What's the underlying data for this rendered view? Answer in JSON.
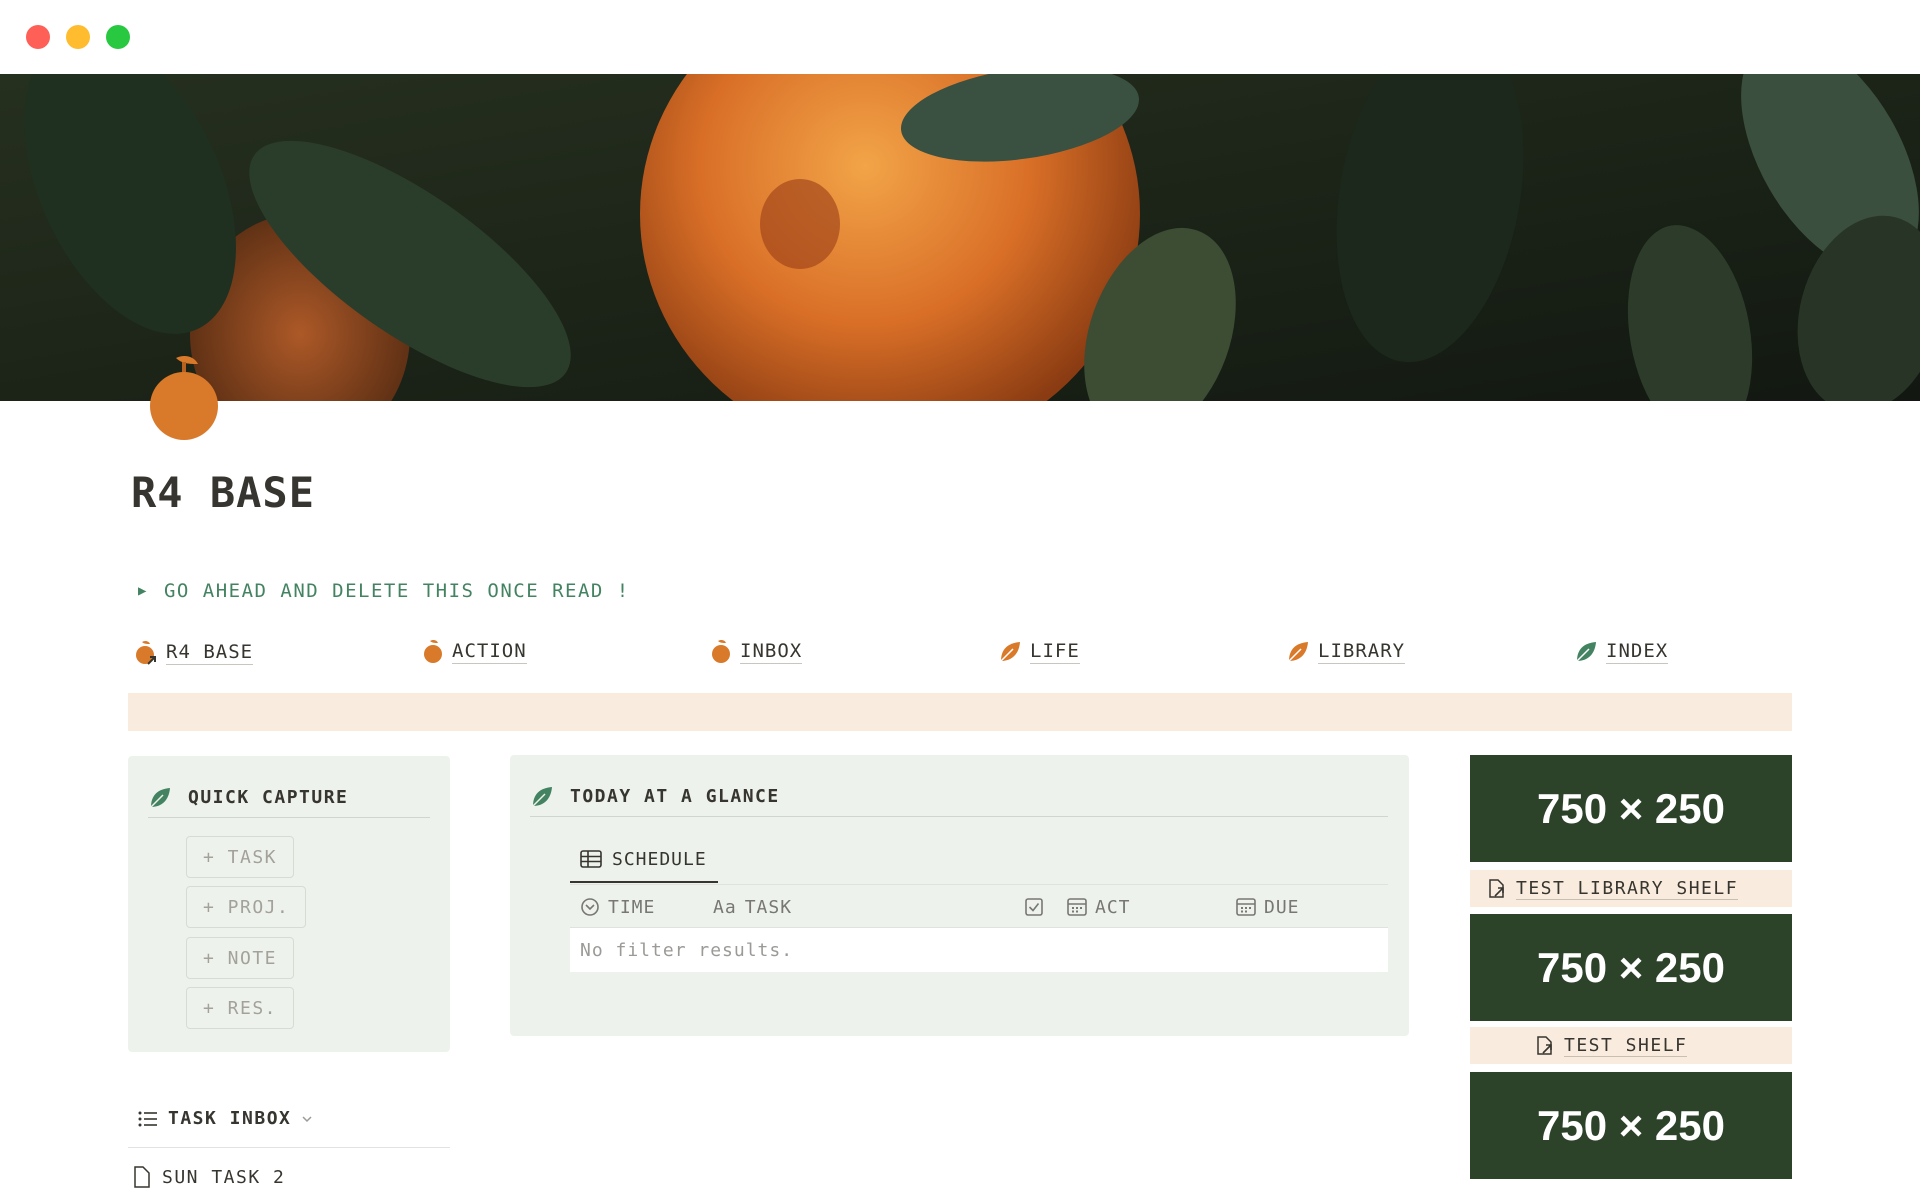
{
  "window": {
    "traffic_lights": {
      "close": "#ff5f57",
      "minimize": "#febc2e",
      "zoom": "#28c840"
    }
  },
  "page": {
    "title": "R4 BASE",
    "toggle_text": "GO AHEAD AND DELETE THIS ONCE READ !"
  },
  "nav": {
    "items": [
      {
        "label": "R4 BASE",
        "icon": "orange-link-icon"
      },
      {
        "label": "ACTION",
        "icon": "orange-icon"
      },
      {
        "label": "INBOX",
        "icon": "orange-icon"
      },
      {
        "label": "LIFE",
        "icon": "leaf-icon"
      },
      {
        "label": "LIBRARY",
        "icon": "leaf-icon"
      },
      {
        "label": "INDEX",
        "icon": "leaf-icon"
      }
    ]
  },
  "quick_capture": {
    "title": "QUICK CAPTURE",
    "buttons": [
      "+ TASK",
      "+ PROJ.",
      "+ NOTE",
      "+ RES."
    ]
  },
  "today": {
    "title": "TODAY AT A GLANCE",
    "tab": "SCHEDULE",
    "columns": [
      {
        "icon": "clock-icon",
        "label": "TIME"
      },
      {
        "icon": "text-icon",
        "prefix": "Aa",
        "label": "TASK"
      },
      {
        "icon": "checkbox-icon",
        "label": ""
      },
      {
        "icon": "calendar-icon",
        "label": "ACT"
      },
      {
        "icon": "calendar-icon",
        "label": "DUE"
      }
    ],
    "empty_text": "No filter results."
  },
  "right_column": {
    "placeholders": [
      "750 × 250",
      "750 × 250",
      "750 × 250"
    ],
    "shelves": [
      "TEST LIBRARY SHELF",
      "TEST SHELF"
    ]
  },
  "task_inbox": {
    "title": "TASK INBOX",
    "rows": [
      "SUN TASK 2"
    ]
  },
  "colors": {
    "accent_green": "#448361",
    "orange": "#d9792a",
    "peach": "#f9ebdd",
    "panel_green": "#edf3ec",
    "dark_green": "#2c432a"
  }
}
